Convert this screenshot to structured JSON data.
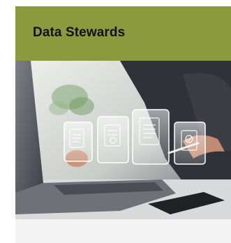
{
  "card": {
    "title": "Data Stewards",
    "header_color": "#8a9a3c",
    "image_icon": "person-using-laptop-with-floating-document-icons"
  }
}
